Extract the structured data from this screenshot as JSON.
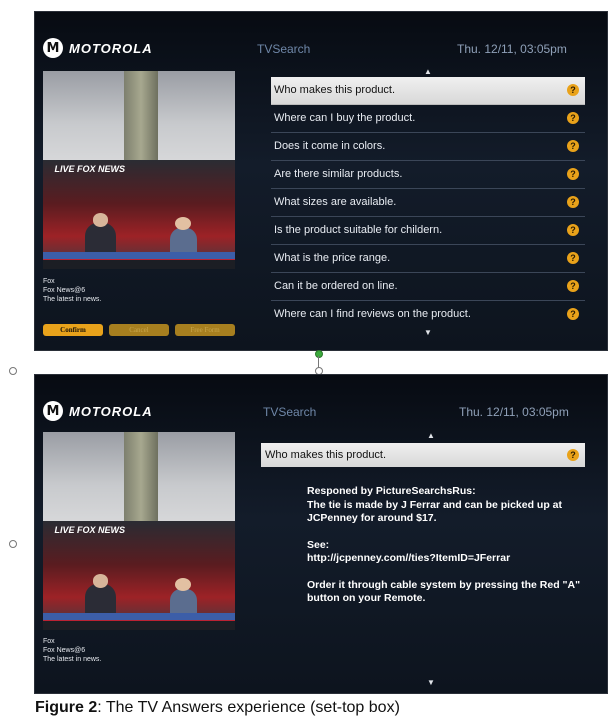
{
  "screen1": {
    "brand": "MOTOROLA",
    "app_title": "TVSearch",
    "clock": "Thu. 12/11, 03:05pm",
    "live_logo": "LIVE FOX NEWS",
    "channel": [
      "Fox",
      "Fox News@6",
      "The latest in news."
    ],
    "buttons": {
      "confirm": "Confirm",
      "cancel": "Cancel",
      "free_form": "Free Form"
    },
    "questions": [
      "Who makes this product.",
      "Where can I buy the product.",
      "Does it come in colors.",
      "Are there similar products.",
      "What sizes are available.",
      "Is the product suitable for childern.",
      "What is the price range.",
      "Can it be ordered on line.",
      "Where can I find reviews on the product."
    ],
    "selected_index": 0
  },
  "screen2": {
    "brand": "MOTOROLA",
    "app_title": "TVSearch",
    "clock": "Thu. 12/11, 03:05pm",
    "live_logo": "LIVE FOX NEWS",
    "channel": [
      "Fox",
      "Fox News@6",
      "The latest in news."
    ],
    "selected_question": "Who makes this product.",
    "answer": {
      "line1": "Responed by PictureSearchsRus:",
      "line2": "The tie is made by J Ferrar and can be picked up at JCPenney for around $17.",
      "see_label": "See:",
      "see_url": "http://jcpenney.com//ties?ItemID=JFerrar",
      "order": "Order it through cable system by pressing the Red \"A\" button on your Remote."
    }
  },
  "caption": {
    "label": "Figure 2",
    "text": ": The TV Answers experience (set-top box)"
  },
  "icons": {
    "question": "question-mark-icon",
    "up": "arrow-up-icon",
    "down": "arrow-down-icon"
  },
  "colors": {
    "accent": "#e9a21a",
    "selected": "#e6e6e6",
    "background": "#0d141e"
  }
}
